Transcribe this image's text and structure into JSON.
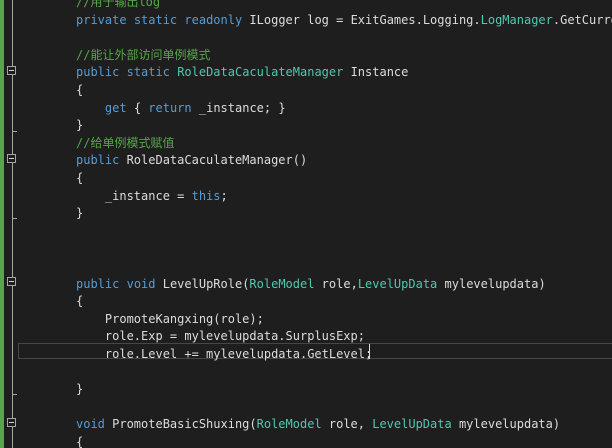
{
  "editor": {
    "lines": [
      {
        "text": "//用于输出log",
        "tokens": [
          {
            "t": "//用于输出log",
            "c": "cm"
          }
        ]
      },
      {
        "text": "private static readonly ILogger log = ExitGames.Logging.LogManager.GetCurre",
        "tokens": [
          {
            "t": "private",
            "c": "kw"
          },
          {
            "t": " ",
            "c": "tx"
          },
          {
            "t": "static",
            "c": "kw"
          },
          {
            "t": " ",
            "c": "tx"
          },
          {
            "t": "readonly",
            "c": "kw"
          },
          {
            "t": " ILogger log = ExitGames.Logging.",
            "c": "tx"
          },
          {
            "t": "LogManager",
            "c": "ty"
          },
          {
            "t": ".GetCurre",
            "c": "tx"
          }
        ]
      },
      {
        "text": "",
        "tokens": []
      },
      {
        "text": "//能让外部访问单例模式",
        "tokens": [
          {
            "t": "//能让外部访问单例模式",
            "c": "cm"
          }
        ]
      },
      {
        "text": "public static RoleDataCaculateManager Instance",
        "tokens": [
          {
            "t": "public",
            "c": "kw"
          },
          {
            "t": " ",
            "c": "tx"
          },
          {
            "t": "static",
            "c": "kw"
          },
          {
            "t": " ",
            "c": "tx"
          },
          {
            "t": "RoleDataCaculateManager",
            "c": "ty"
          },
          {
            "t": " Instance",
            "c": "tx"
          }
        ]
      },
      {
        "text": "{",
        "tokens": [
          {
            "t": "{",
            "c": "tx"
          }
        ]
      },
      {
        "text": "    get { return _instance; }",
        "tokens": [
          {
            "t": "    ",
            "c": "tx"
          },
          {
            "t": "get",
            "c": "kw"
          },
          {
            "t": " { ",
            "c": "tx"
          },
          {
            "t": "return",
            "c": "kw"
          },
          {
            "t": " _instance; }",
            "c": "tx"
          }
        ]
      },
      {
        "text": "}",
        "tokens": [
          {
            "t": "}",
            "c": "tx"
          }
        ]
      },
      {
        "text": "//给单例模式赋值",
        "tokens": [
          {
            "t": "//给单例模式赋值",
            "c": "cm"
          }
        ]
      },
      {
        "text": "public RoleDataCaculateManager()",
        "tokens": [
          {
            "t": "public",
            "c": "kw"
          },
          {
            "t": " RoleDataCaculateManager()",
            "c": "tx"
          }
        ]
      },
      {
        "text": "{",
        "tokens": [
          {
            "t": "{",
            "c": "tx"
          }
        ]
      },
      {
        "text": "    _instance = this;",
        "tokens": [
          {
            "t": "    _instance = ",
            "c": "tx"
          },
          {
            "t": "this",
            "c": "kw"
          },
          {
            "t": ";",
            "c": "tx"
          }
        ]
      },
      {
        "text": "}",
        "tokens": [
          {
            "t": "}",
            "c": "tx"
          }
        ]
      },
      {
        "text": "",
        "tokens": []
      },
      {
        "text": "",
        "tokens": []
      },
      {
        "text": "",
        "tokens": []
      },
      {
        "text": "public void LevelUpRole(RoleModel role,LevelUpData mylevelupdata)",
        "tokens": [
          {
            "t": "public",
            "c": "kw"
          },
          {
            "t": " ",
            "c": "tx"
          },
          {
            "t": "void",
            "c": "kw"
          },
          {
            "t": " LevelUpRole(",
            "c": "tx"
          },
          {
            "t": "RoleModel",
            "c": "ty"
          },
          {
            "t": " role,",
            "c": "tx"
          },
          {
            "t": "LevelUpData",
            "c": "ty"
          },
          {
            "t": " mylevelupdata)",
            "c": "tx"
          }
        ]
      },
      {
        "text": "{",
        "tokens": [
          {
            "t": "{",
            "c": "tx"
          }
        ]
      },
      {
        "text": "    PromoteKangxing(role);",
        "tokens": [
          {
            "t": "    PromoteKangxing(role);",
            "c": "tx"
          }
        ]
      },
      {
        "text": "    role.Exp = mylevelupdata.SurplusExp;",
        "tokens": [
          {
            "t": "    role.Exp = mylevelupdata.SurplusExp;",
            "c": "tx"
          }
        ]
      },
      {
        "text": "    role.Level += mylevelupdata.GetLevel;",
        "tokens": [
          {
            "t": "    role.Level += mylevelupdata.GetLevel;",
            "c": "tx"
          }
        ]
      },
      {
        "text": "",
        "tokens": []
      },
      {
        "text": "}",
        "tokens": [
          {
            "t": "}",
            "c": "tx"
          }
        ]
      },
      {
        "text": "",
        "tokens": []
      },
      {
        "text": "void PromoteBasicShuxing(RoleModel role, LevelUpData mylevelupdata)",
        "tokens": [
          {
            "t": "void",
            "c": "kw"
          },
          {
            "t": " PromoteBasicShuxing(",
            "c": "tx"
          },
          {
            "t": "RoleModel",
            "c": "ty"
          },
          {
            "t": " role, ",
            "c": "tx"
          },
          {
            "t": "LevelUpData",
            "c": "ty"
          },
          {
            "t": " mylevelupdata)",
            "c": "tx"
          }
        ]
      },
      {
        "text": "{",
        "tokens": [
          {
            "t": "{",
            "c": "tx"
          }
        ]
      }
    ],
    "current_line": 20,
    "colors": {
      "background": "#1e1e1e",
      "keyword": "#569cd6",
      "type": "#4ec9b0",
      "comment": "#57a64a",
      "text": "#dcdcdc",
      "change_bar": "#57a64a"
    }
  }
}
